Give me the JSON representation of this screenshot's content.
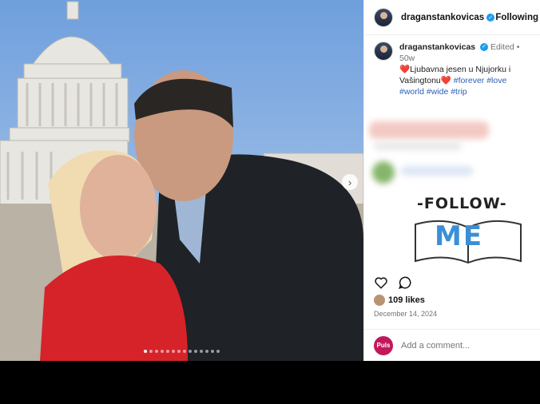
{
  "post": {
    "username": "draganstankovicas",
    "follow_label": "Following",
    "edited_label": "Edited",
    "age": "50w",
    "caption_heart_1": "❤️",
    "caption_text": "Ljubavna jesen u Njujorku i Vašingtonu",
    "caption_heart_2": "❤️",
    "hashtags": [
      "#forever",
      "#love",
      "#world",
      "#wide",
      "#trip"
    ],
    "sticker_top": "-FOLLOW-",
    "sticker_bottom": "ME",
    "likes": "109 likes",
    "date": "December 14, 2024",
    "commenter_badge": "Puls",
    "add_comment_placeholder": "Add a comment...",
    "carousel": {
      "count": 14,
      "active_index": 0
    }
  },
  "icons": {
    "verified": "verified-badge-icon",
    "like": "heart-outline-icon",
    "comment": "comment-bubble-icon",
    "next": "chevron-right-icon"
  },
  "colors": {
    "hashtag": "#2b5fb4",
    "verified": "#1d9bf0",
    "heart": "#e0245e",
    "puls_badge": "#c2185b"
  }
}
